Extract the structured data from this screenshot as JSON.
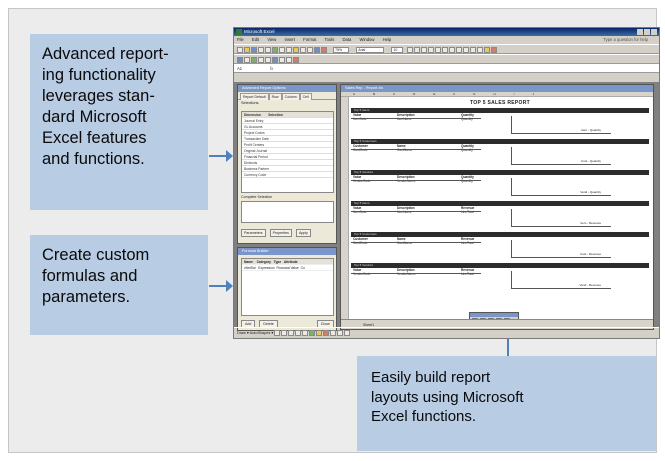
{
  "callouts": {
    "reporting": [
      "Advanced report-",
      "ing functionality",
      "leverages stan-",
      "dard Microsoft",
      "Excel features",
      "and functions."
    ],
    "formulas": [
      "Create custom",
      "formulas and",
      "parameters."
    ],
    "layouts": [
      "Easily build report",
      "layouts using Microsoft",
      "Excel functions."
    ]
  },
  "colors": {
    "callout_bg": "#b8cce4",
    "arrow": "#4f81bd",
    "panel_bg": "#ececec"
  },
  "excel": {
    "window_title": "Microsoft Excel",
    "menu": [
      "File",
      "Edit",
      "View",
      "Insert",
      "Format",
      "Tools",
      "Data",
      "Window",
      "Help"
    ],
    "ask": "Type a question for help",
    "font_name": "Arial",
    "font_size": "10",
    "zoom": "75%",
    "cell_ref": "A1",
    "side_panel": {
      "title": "Advanced Report Options",
      "tabs": [
        "Report Default",
        "Row",
        "Column",
        "Cell"
      ],
      "selections_label": "Selections",
      "grid_header": [
        "Dimension",
        "Selection"
      ],
      "grid_rows": [
        "Journal Entry",
        "GL Accounts",
        "Project Codes",
        "Transaction Date",
        "Profit Centers",
        "Original Journal",
        "Financial Period",
        "Divisions",
        "Business Partner",
        "Currency Code"
      ],
      "complete_selection_label": "Complete Selection",
      "buttons": [
        "Parameters",
        "Properties",
        "Apply"
      ]
    },
    "formula_panel": {
      "title": "Formula Builder",
      "headers": [
        "Name",
        "Category",
        "Type",
        "Attribute"
      ],
      "row": [
        "vNetSal",
        "Expression",
        "Financial Value",
        "Cu"
      ],
      "buttons": [
        "Add",
        "Delete",
        "Close"
      ]
    },
    "sheet": {
      "title": "Sales Rep - Report.xls",
      "report_title": "TOP 5 SALES REPORT",
      "sections": [
        {
          "bar": "Top 5 Items",
          "h": [
            "Value",
            "Description",
            "Quantity"
          ],
          "v": [
            "ItemCode",
            "ItemName",
            "Quantity"
          ],
          "chart": "Item - Quantity"
        },
        {
          "bar": "Top 5 Customers",
          "h": [
            "Customer",
            "Name",
            "Quantity"
          ],
          "v": [
            "CardCode",
            "CardName",
            "Quantity"
          ],
          "chart": "Cust - Quantity"
        },
        {
          "bar": "Top 5 Vendors",
          "h": [
            "Value",
            "Description",
            "Quantity"
          ],
          "v": [
            "VendorCode",
            "VendorName",
            "Quantity"
          ],
          "chart": "Vend - Quantity"
        },
        {
          "bar": "Top 5 Items",
          "h": [
            "Value",
            "Description",
            "Revenue"
          ],
          "v": [
            "ItemCode",
            "ItemName",
            "LineTotal"
          ],
          "chart": "Item - Revenue"
        },
        {
          "bar": "Top 5 Customers",
          "h": [
            "Customer",
            "Name",
            "Revenue"
          ],
          "v": [
            "CardCode",
            "CardName",
            "LineTotal"
          ],
          "chart": "Cust - Revenue"
        },
        {
          "bar": "Top 5 Vendors",
          "h": [
            "Value",
            "Description",
            "Revenue"
          ],
          "v": [
            "VendorCode",
            "VendorName",
            "LineTotal"
          ],
          "chart": "Vend - Revenue"
        }
      ],
      "sheet_tab": "Sheet1"
    },
    "draw_bar": "Draw ▾   AutoShapes ▾"
  }
}
